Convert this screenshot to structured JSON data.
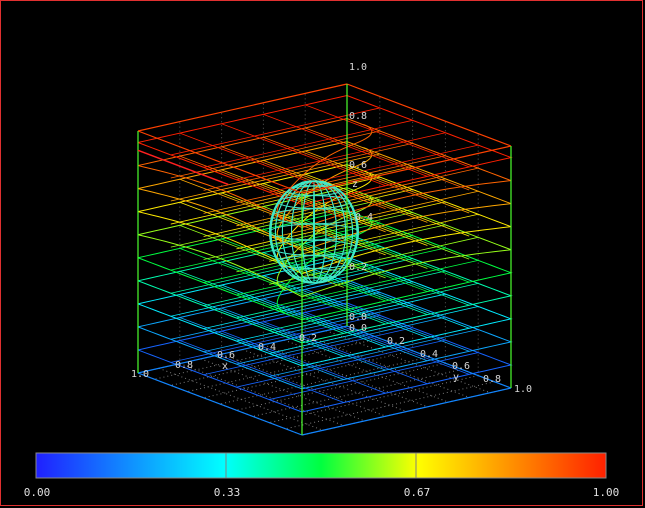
{
  "scene": {
    "axis_corner_labels": [
      "1.0",
      "1.0",
      "1.0"
    ],
    "z_ticks": [
      "0.0",
      "0.2",
      "0.4",
      "0.6",
      "0.8"
    ],
    "z_axis_letter": "z",
    "x_ticks": [
      "0.8",
      "0.6",
      "0.4",
      "0.2"
    ],
    "x_axis_letter": "x",
    "y_ticks": [
      "0.2",
      "0.4",
      "0.6",
      "0.8"
    ],
    "y_axis_letter": "y",
    "origin_label": "0.0"
  },
  "colorbar": {
    "min_label": "0.00",
    "q1_label": "0.33",
    "q2_label": "0.67",
    "max_label": "1.00",
    "colors": [
      "#2020ff",
      "#00ffff",
      "#00ff00",
      "#ffff00",
      "#ff2000"
    ]
  },
  "colors": {
    "frame": "#e03030",
    "sphere": "#40e8c8",
    "grid_dim": "#6a6a6a"
  }
}
